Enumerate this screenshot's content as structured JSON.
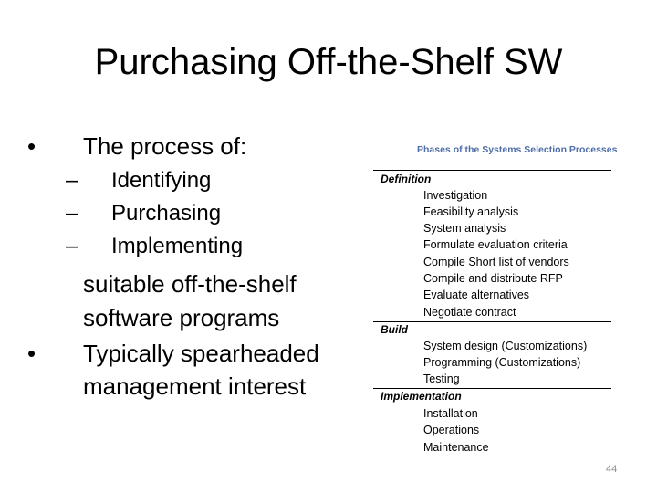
{
  "slide": {
    "title": "Purchasing Off-the-Shelf SW",
    "bullets": [
      {
        "marker": "•",
        "text": "The process of:",
        "sub_items": [
          {
            "marker": "–",
            "text": "Identifying"
          },
          {
            "marker": "–",
            "text": "Purchasing"
          },
          {
            "marker": "–",
            "text": "Implementing"
          }
        ],
        "continuation": [
          "suitable off-the-shelf",
          "software programs"
        ]
      },
      {
        "marker": "•",
        "lines": [
          "Typically spearheaded",
          "management interest"
        ]
      }
    ],
    "page_number": "44"
  },
  "figure": {
    "title": "Phases of the Systems Selection Processes",
    "title_color": "#4f6fa8",
    "phases": [
      {
        "name": "Definition",
        "steps": [
          "Investigation",
          "Feasibility analysis",
          "System analysis",
          "Formulate evaluation criteria",
          "Compile Short list of vendors",
          "Compile and distribute RFP",
          "Evaluate alternatives",
          "Negotiate contract"
        ]
      },
      {
        "name": "Build",
        "steps": [
          "System design (Customizations)",
          "Programming (Customizations)",
          "Testing"
        ]
      },
      {
        "name": "Implementation",
        "steps": [
          "Installation",
          "Operations",
          "Maintenance"
        ]
      }
    ]
  }
}
